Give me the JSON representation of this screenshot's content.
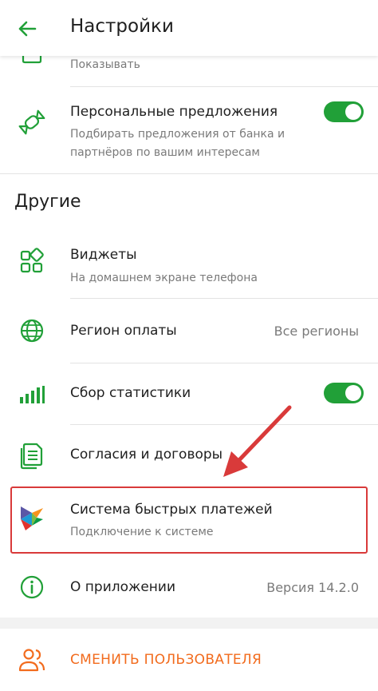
{
  "appbar": {
    "title": "Настройки"
  },
  "partial_row": {
    "subtitle": "Показывать"
  },
  "offers": {
    "title": "Персональные предложения",
    "subtitle_line1": "Подбирать предложения от банка и",
    "subtitle_line2": "партнёров по вашим интересам",
    "toggle_on": true
  },
  "section_other": {
    "title": "Другие"
  },
  "widgets": {
    "title": "Виджеты",
    "subtitle": "На домашнем экране телефона"
  },
  "region": {
    "title": "Регион оплаты",
    "value": "Все регионы"
  },
  "stats": {
    "title": "Сбор статистики",
    "toggle_on": true
  },
  "consents": {
    "title": "Согласия и договоры"
  },
  "sbp": {
    "title": "Система быстрых платежей",
    "subtitle": "Подключение к системе"
  },
  "about": {
    "title": "О приложении",
    "value": "Версия 14.2.0"
  },
  "switch_user": {
    "label": "СМЕНИТЬ ПОЛЬЗОВАТЕЛЯ"
  },
  "colors": {
    "accent_green": "#21a038",
    "highlight_red": "#d93a3a",
    "switch_user_orange": "#f26b1d"
  },
  "icons": {
    "back": "arrow-left-icon",
    "offers": "candy-icon",
    "widgets": "widgets-grid-icon",
    "region": "globe-icon",
    "stats": "bar-chart-icon",
    "consents": "documents-icon",
    "sbp": "sbp-logo-icon",
    "about": "info-icon",
    "switch_user": "users-icon"
  }
}
